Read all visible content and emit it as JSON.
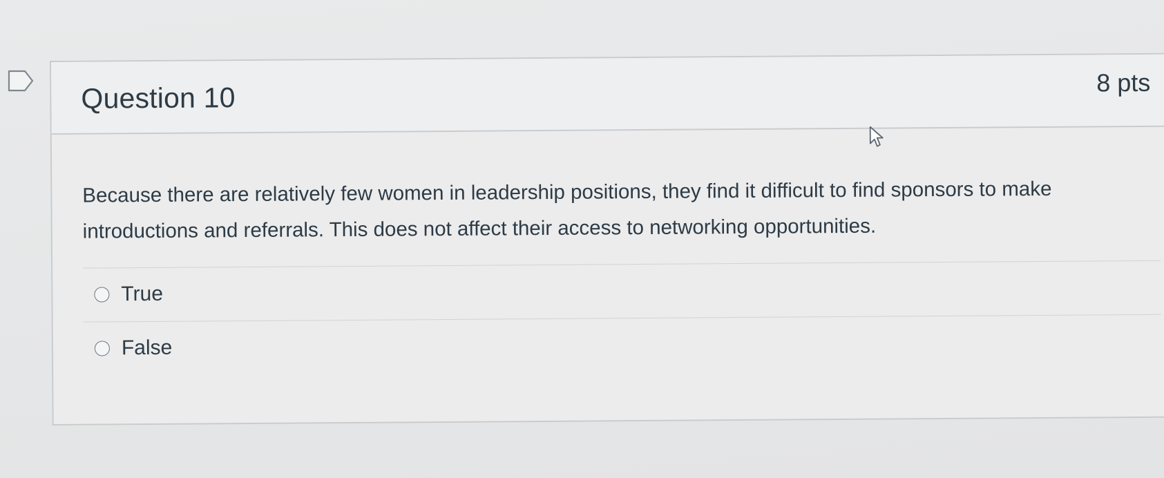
{
  "question": {
    "title": "Question 10",
    "points": "8 pts",
    "text": "Because there are relatively few women in leadership positions, they find it difficult to find sponsors to make introductions and referrals. This does not affect their access to networking opportunities.",
    "answers": [
      {
        "label": "True",
        "selected": false
      },
      {
        "label": "False",
        "selected": false
      }
    ]
  },
  "colors": {
    "text": "#2d3b45",
    "border": "#c9cccf",
    "background": "#e6e7e8"
  },
  "icons": {
    "flag": "flag-question-icon",
    "cursor": "mouse-pointer-icon",
    "radio": "radio-button-icon"
  }
}
